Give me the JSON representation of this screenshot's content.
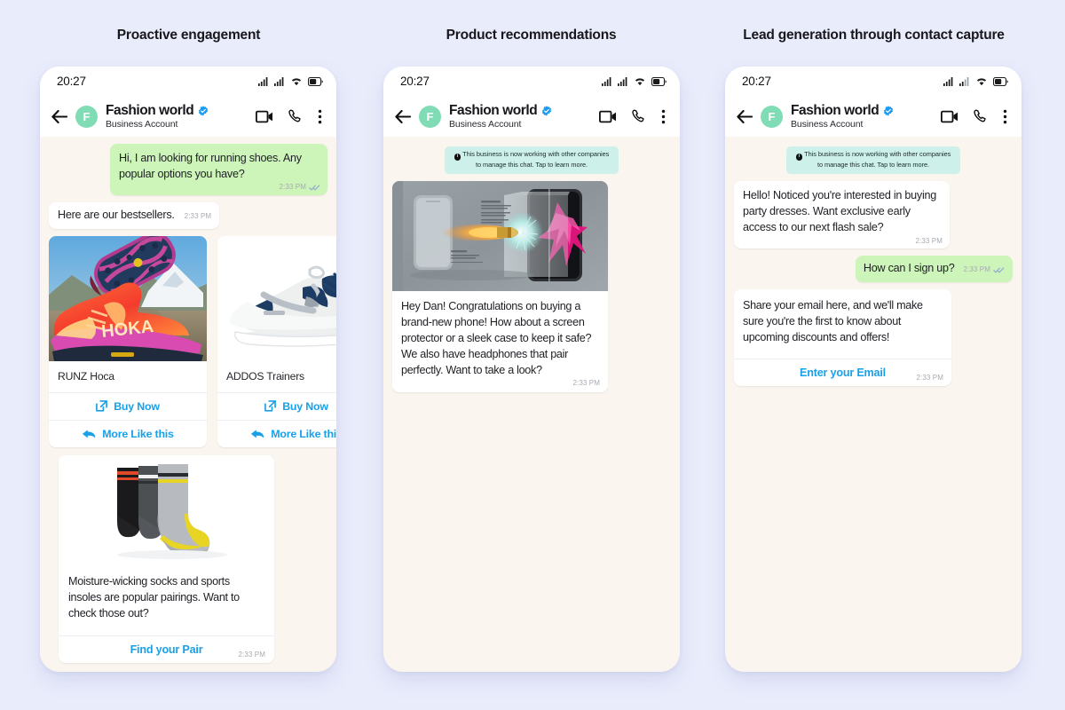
{
  "page": {
    "background_color": "#e9ecfb",
    "headings": [
      "Proactive engagement",
      "Product recommendations",
      "Lead generation through contact capture"
    ]
  },
  "colors": {
    "chat_background": "#faf5ef",
    "outgoing_bubble": "#cdf5ba",
    "incoming_bubble": "#ffffff",
    "accent_link": "#1aa0e8",
    "avatar": "#7fdcb4",
    "verified_badge": "#1d9bf0",
    "notice_background": "#cdf0eb"
  },
  "phone_chrome": {
    "clock": "20:27",
    "status_icons": [
      "signal-bars-icon",
      "signal-bars-icon",
      "wifi-icon",
      "battery-icon"
    ],
    "back_icon": "back-arrow-icon",
    "avatar_initial": "F",
    "business_name": "Fashion world",
    "business_subtitle": "Business Account",
    "verified_icon": "verified-badge-icon",
    "header_icons": [
      "video-call-icon",
      "voice-call-icon",
      "overflow-menu-icon"
    ]
  },
  "system_notice": {
    "icon": "info-icon",
    "text": "This business is now working with other companies to manage this chat. Tap to learn more."
  },
  "panel_1": {
    "name": "Proactive engagement",
    "messages": [
      {
        "id": "m1",
        "direction": "outgoing",
        "text": "Hi, I am looking for running shoes. Any popular options you have?",
        "time": "2:33 PM",
        "receipt": "double-check-icon"
      },
      {
        "id": "m2",
        "direction": "incoming",
        "text": "Here are our bestsellers.",
        "time": "2:33 PM"
      }
    ],
    "product_cards": [
      {
        "title": "RUNZ Hoca",
        "image": "hoka-running-shoe-photo",
        "buy_label": "Buy Now",
        "buy_icon": "external-link-icon",
        "more_label": "More Like this",
        "more_icon": "reply-arrow-icon"
      },
      {
        "title": "ADDOS Trainers",
        "image": "white-navy-trainer-photo",
        "buy_label": "Buy Now",
        "buy_icon": "external-link-icon",
        "more_label": "More Like this",
        "more_icon": "reply-arrow-icon"
      }
    ],
    "socks_card": {
      "image": "three-pairs-of-socks-photo",
      "text": "Moisture-wicking socks and sports insoles are popular pairings. Want to check those out?",
      "time": "2:33 PM",
      "button_label": "Find your Pair"
    }
  },
  "panel_2": {
    "name": "Product recommendations",
    "media_message": {
      "image": "screen-protector-bullet-ad",
      "text": "Hey Dan! Congratulations on buying a brand-new phone! How about a screen protector or a sleek case to keep it safe? We also have headphones that pair perfectly. Want to take a look?",
      "time": "2:33 PM"
    }
  },
  "panel_3": {
    "name": "Lead generation through contact capture",
    "messages": [
      {
        "id": "l1",
        "direction": "incoming",
        "text": "Hello! Noticed you're interested in buying party dresses. Want exclusive early access to our next flash sale?",
        "time": "2:33 PM"
      },
      {
        "id": "l2",
        "direction": "outgoing",
        "text": "How can I sign up?",
        "time": "2:33 PM",
        "receipt": "double-check-icon"
      }
    ],
    "email_card": {
      "text": "Share your email here, and we'll make sure you're the first to know about upcoming discounts and offers!",
      "time": "2:33 PM",
      "button_label": "Enter your Email"
    }
  }
}
